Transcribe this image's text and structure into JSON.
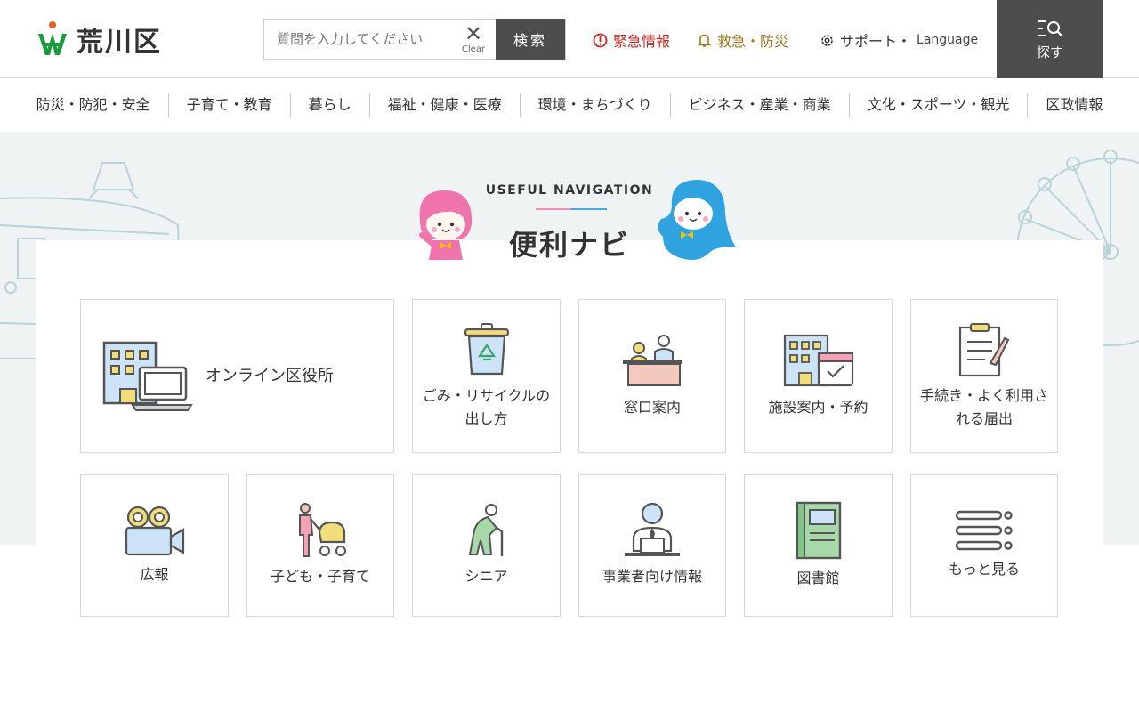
{
  "header": {
    "logo_text": "荒川区",
    "search": {
      "placeholder": "質問を入力してください",
      "clear_label": "Clear",
      "button_label": "検索"
    },
    "links": {
      "emergency": "緊急情報",
      "disaster": "救急・防災",
      "support": "サポート・",
      "language": "Language"
    },
    "find_label": "探す"
  },
  "gnav": [
    "防災・防犯・安全",
    "子育て・教育",
    "暮らし",
    "福祉・健康・医療",
    "環境・まちづくり",
    "ビジネス・産業・商業",
    "文化・スポーツ・観光",
    "区政情報"
  ],
  "navigation": {
    "subtitle": "USEFUL NAVIGATION",
    "title": "便利ナビ",
    "tiles": [
      {
        "label": "オンライン区役所",
        "icon": "online-office-icon"
      },
      {
        "label": "ごみ・リサイクルの出し方",
        "icon": "recycle-bin-icon"
      },
      {
        "label": "窓口案内",
        "icon": "counter-icon"
      },
      {
        "label": "施設案内・予約",
        "icon": "facility-calendar-icon"
      },
      {
        "label": "手続き・よく利用される届出",
        "icon": "clipboard-icon"
      },
      {
        "label": "広報",
        "icon": "video-camera-icon"
      },
      {
        "label": "子ども・子育て",
        "icon": "stroller-icon"
      },
      {
        "label": "シニア",
        "icon": "senior-cane-icon"
      },
      {
        "label": "事業者向け情報",
        "icon": "business-person-icon"
      },
      {
        "label": "図書館",
        "icon": "book-icon"
      },
      {
        "label": "もっと見る",
        "icon": "list-icon"
      }
    ]
  },
  "colors": {
    "accent_dark": "#4d4d4d",
    "emergency": "#c5231f",
    "disaster": "#9a7a1d",
    "logo_green": "#1a9a3c",
    "logo_orange": "#e5601e"
  }
}
